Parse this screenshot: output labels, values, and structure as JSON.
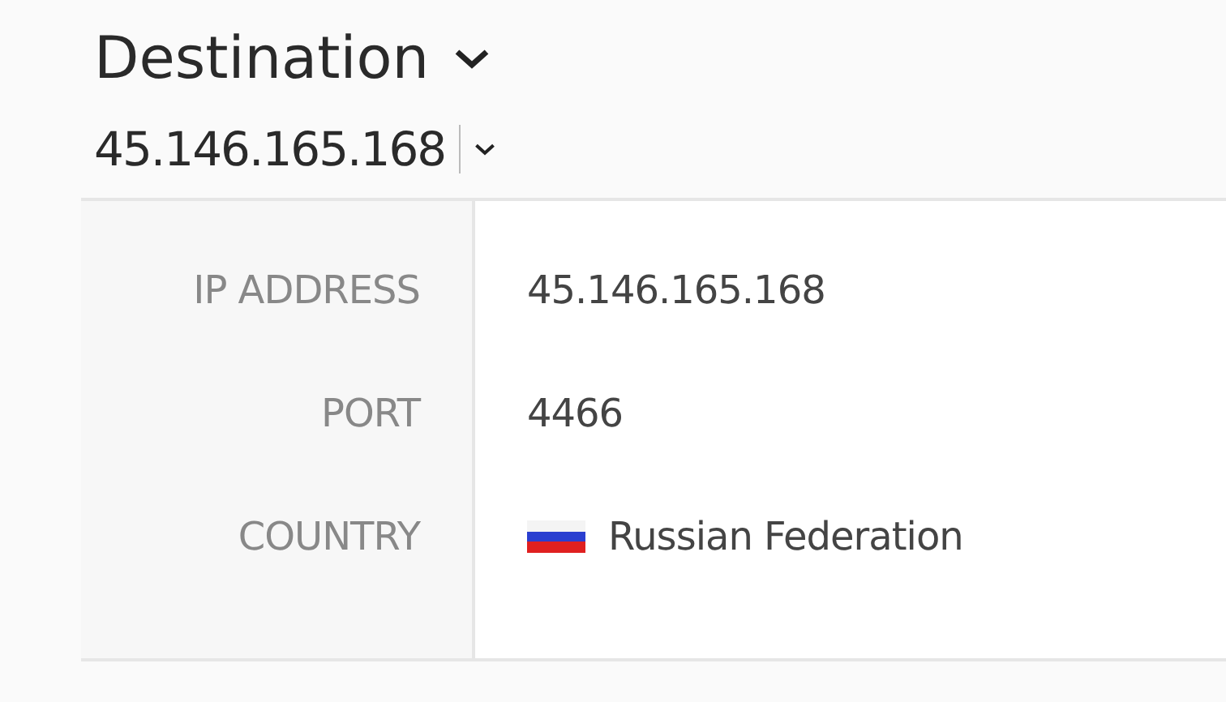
{
  "section": {
    "title": "Destination",
    "expanded": true
  },
  "selector": {
    "value": "45.146.165.168"
  },
  "details": [
    {
      "label": "IP ADDRESS",
      "value": "45.146.165.168",
      "kind": "text"
    },
    {
      "label": "PORT",
      "value": "4466",
      "kind": "text"
    },
    {
      "label": "COUNTRY",
      "value": "Russian Federation",
      "kind": "flag"
    }
  ]
}
